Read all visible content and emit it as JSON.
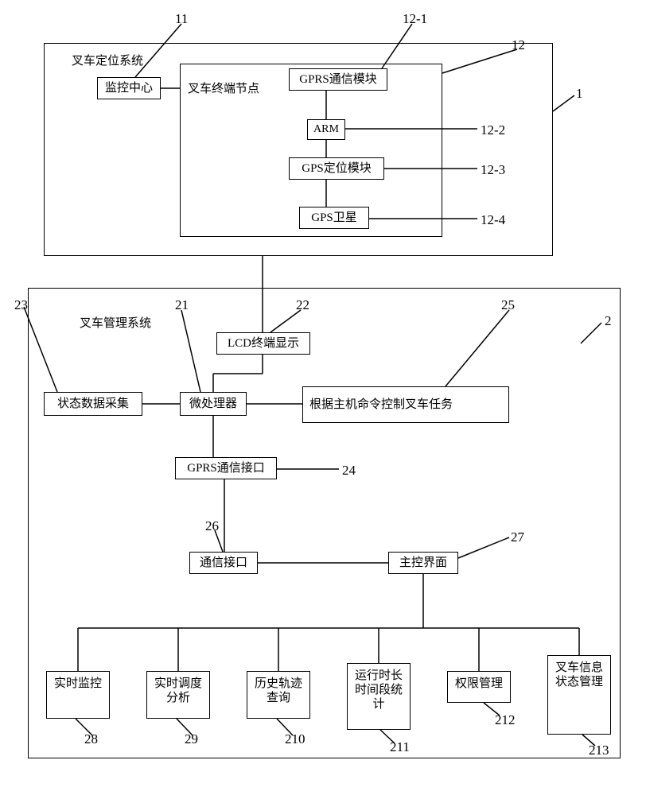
{
  "top": {
    "title": "叉车定位系统",
    "monitor": "监控中心",
    "terminal_node": "叉车终端节点",
    "gprs_module": "GPRS通信模块",
    "arm": "ARM",
    "gps_module": "GPS定位模块",
    "gps_sat": "GPS卫星"
  },
  "bottom": {
    "title": "叉车管理系统",
    "lcd": "LCD终端显示",
    "status_collect": "状态数据采集",
    "micro": "微处理器",
    "task_control": "根据主机命令控制叉车任务",
    "gprs_if": "GPRS通信接口",
    "comm_if": "通信接口",
    "main_ui": "主控界面",
    "f28": "实时监控",
    "f29": "实时调度分析",
    "f210": "历史轨迹查询",
    "f211": "运行时长时间段统计",
    "f212": "权限管理",
    "f213": "叉车信息状态管理"
  },
  "labels": {
    "n11": "11",
    "n12_1": "12-1",
    "n12": "12",
    "n1": "1",
    "n12_2": "12-2",
    "n12_3": "12-3",
    "n12_4": "12-4",
    "n23": "23",
    "n21": "21",
    "n22": "22",
    "n25": "25",
    "n2": "2",
    "n24": "24",
    "n26": "26",
    "n27": "27",
    "n28": "28",
    "n29": "29",
    "n210": "210",
    "n211": "211",
    "n212": "212",
    "n213": "213"
  }
}
